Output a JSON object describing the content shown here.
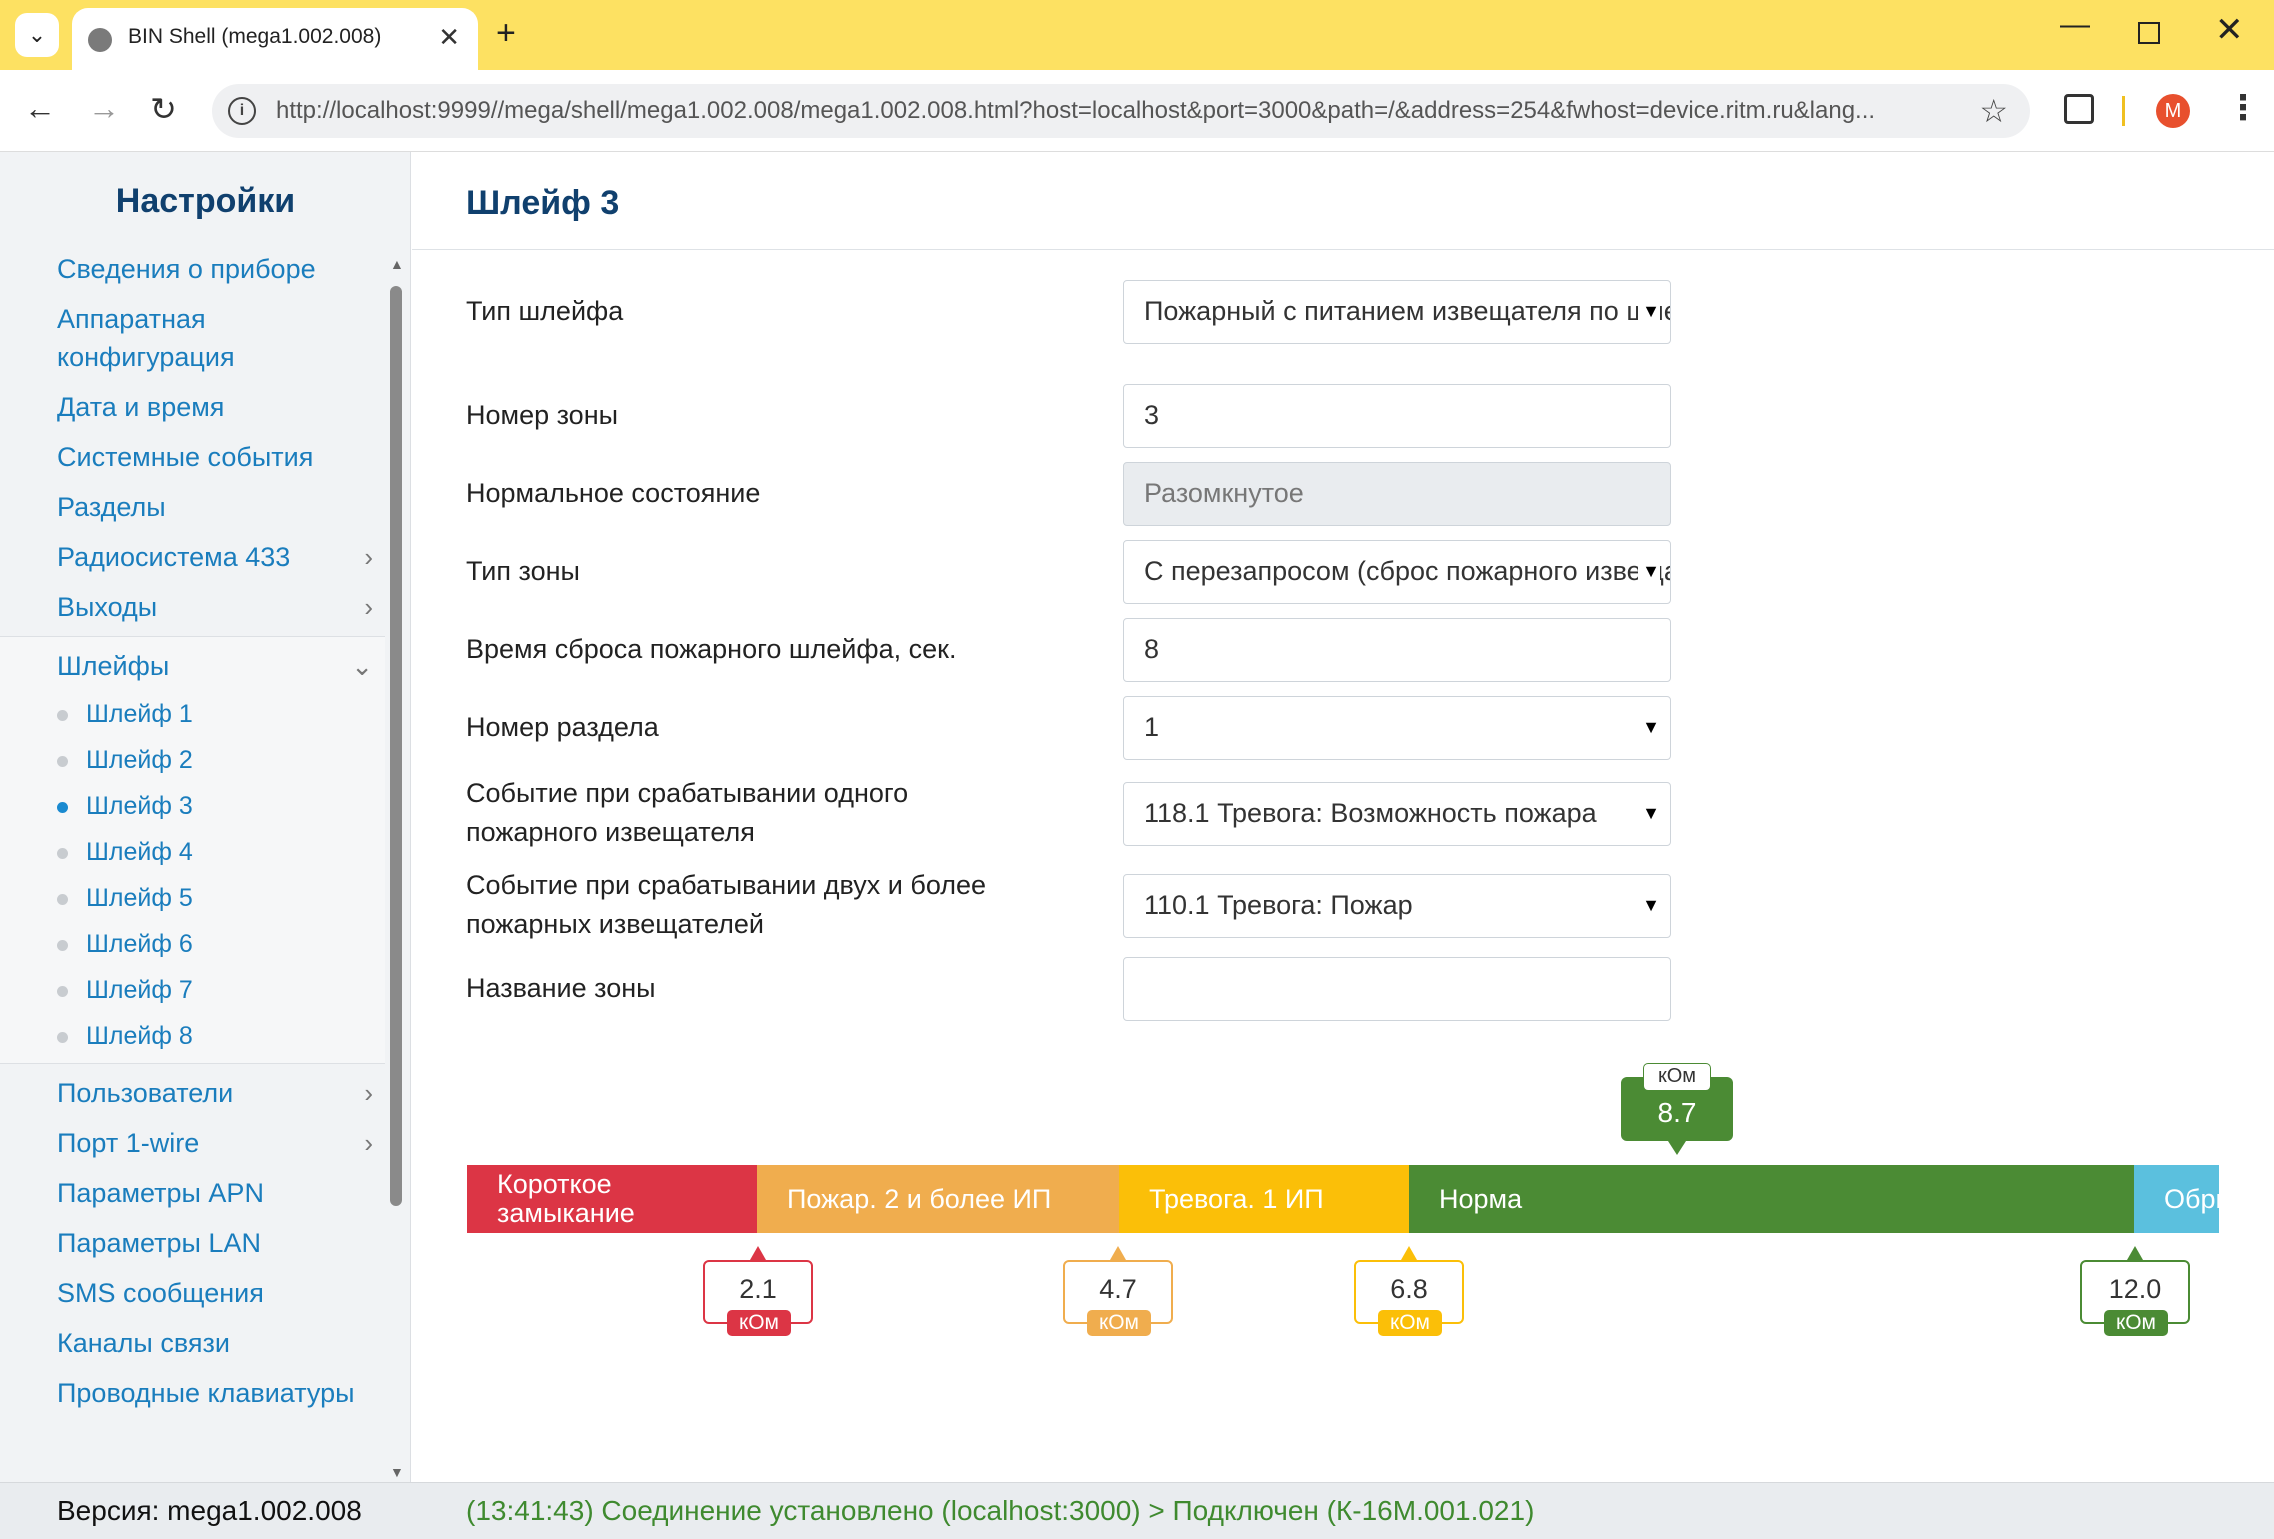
{
  "browser": {
    "tab_title": "BIN Shell (mega1.002.008)",
    "url": "http://localhost:9999//mega/shell/mega1.002.008/mega1.002.008.html?host=localhost&port=3000&path=/&address=254&fwhost=device.ritm.ru&lang...",
    "avatar_letter": "M"
  },
  "sidebar": {
    "title": "Настройки",
    "items_top": [
      {
        "label": "Сведения о приборе"
      },
      {
        "label": "Аппаратная конфигурация"
      },
      {
        "label": "Дата и время"
      },
      {
        "label": "Системные события"
      },
      {
        "label": "Разделы"
      },
      {
        "label": "Радиосистема 433"
      },
      {
        "label": "Выходы"
      }
    ],
    "group": {
      "label": "Шлейфы",
      "subitems": [
        "Шлейф 1",
        "Шлейф 2",
        "Шлейф 3",
        "Шлейф 4",
        "Шлейф 5",
        "Шлейф 6",
        "Шлейф 7",
        "Шлейф 8"
      ],
      "active_index": 2
    },
    "items_bottom": [
      {
        "label": "Пользователи"
      },
      {
        "label": "Порт 1-wire"
      },
      {
        "label": "Параметры APN"
      },
      {
        "label": "Параметры LAN"
      },
      {
        "label": "SMS сообщения"
      },
      {
        "label": "Каналы связи"
      },
      {
        "label": "Проводные клавиатуры"
      }
    ]
  },
  "page": {
    "title": "Шлейф 3",
    "fields": {
      "loop_type": {
        "label": "Тип шлейфа",
        "value": "Пожарный с питанием извещателя по шлейфу"
      },
      "zone_number": {
        "label": "Номер зоны",
        "value": "3"
      },
      "normal_state": {
        "label": "Нормальное состояние",
        "value": "Разомкнутое"
      },
      "zone_type": {
        "label": "Тип зоны",
        "value": "С перезапросом (сброс пожарного извещателя)"
      },
      "reset_time": {
        "label": "Время сброса пожарного шлейфа, сек.",
        "value": "8"
      },
      "partition": {
        "label": "Номер раздела",
        "value": "1"
      },
      "event_one": {
        "label": "Событие при срабатывании одного пожарного извещателя",
        "value": "118.1 Тревога: Возможность пожара"
      },
      "event_two": {
        "label": "Событие при срабатывании двух и более пожарных извещателей",
        "value": "110.1 Тревога: Пожар"
      },
      "zone_name": {
        "label": "Название зоны",
        "value": ""
      }
    }
  },
  "scale": {
    "segments": [
      {
        "label": "Короткое замыкание",
        "color": "#dc3545"
      },
      {
        "label": "Пожар. 2 и более ИП",
        "color": "#f0ad4e"
      },
      {
        "label": "Тревога. 1 ИП",
        "color": "#fbbf08"
      },
      {
        "label": "Норма",
        "color": "#4b8b34"
      },
      {
        "label": "Обрыв",
        "color": "#5bc0de"
      }
    ],
    "thresholds": [
      {
        "value": "2.1",
        "unit": "кОм",
        "color": "#dc3545"
      },
      {
        "value": "4.7",
        "unit": "кОм",
        "color": "#f0ad4e"
      },
      {
        "value": "6.8",
        "unit": "кОм",
        "color": "#fbbf08"
      },
      {
        "value": "12.0",
        "unit": "кОм",
        "color": "#4b8b34"
      }
    ],
    "current": {
      "value": "8.7",
      "unit": "кОм",
      "color": "#4b8b34"
    }
  },
  "status": {
    "version": "Версия: mega1.002.008",
    "message": "(13:41:43) Соединение установлено (localhost:3000) > Подключен (К-16М.001.021)"
  }
}
